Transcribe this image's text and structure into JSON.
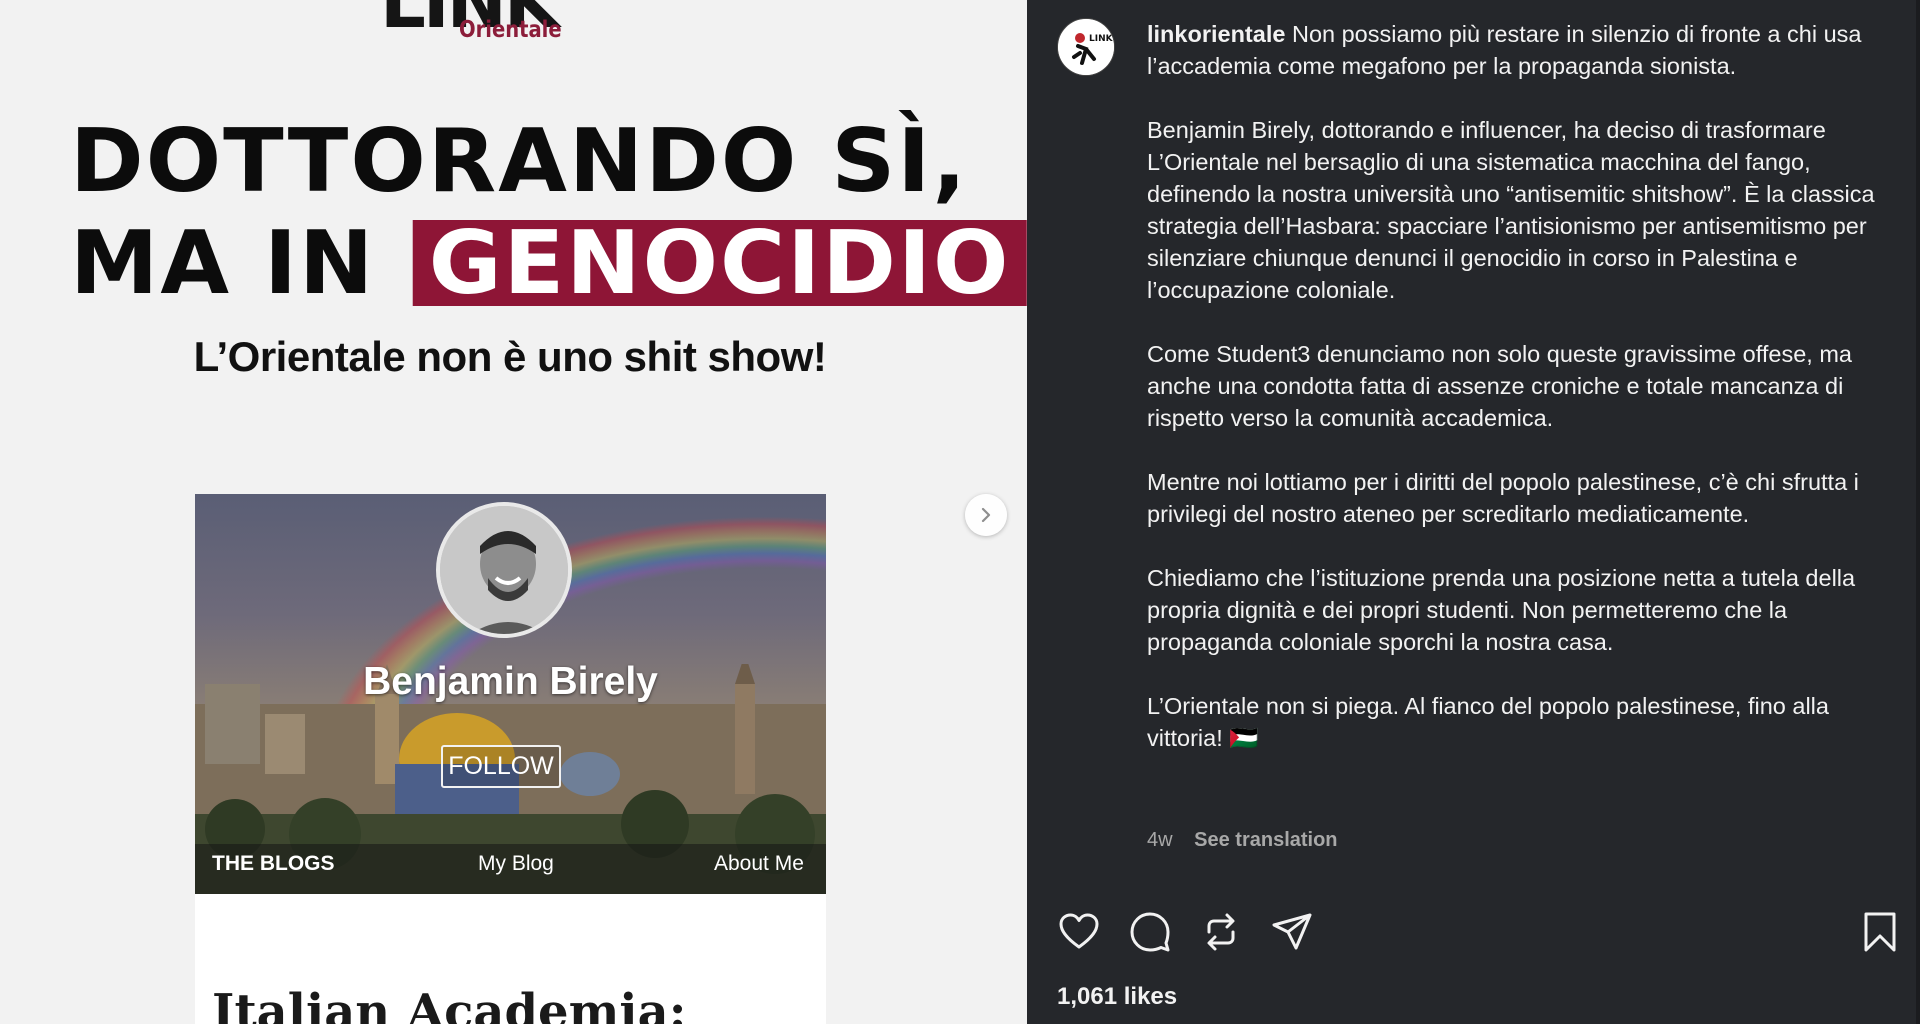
{
  "post_image": {
    "logo_word": "LINK",
    "logo_sub": "Orientale",
    "headline_line1": "DOTTORANDO SÌ,",
    "headline_line2_prefix": "MA IN",
    "headline_highlight": "GENOCIDIO",
    "subheadline": "L’Orientale non è uno shit show!",
    "blog": {
      "author_name": "Benjamin Birely",
      "follow_label": "FOLLOW",
      "nav": [
        "THE BLOGS",
        "My Blog",
        "About Me"
      ],
      "article_title": "Italian Academia:"
    }
  },
  "post": {
    "username": "linkorientale",
    "caption_first": "Non possiamo più restare in silenzio di fronte a chi usa l’accademia come megafono per la propaganda sionista.",
    "caption_paragraphs": [
      "Benjamin Birely, dottorando e influencer, ha deciso di trasformare L’Orientale nel bersaglio di una sistematica macchina del fango, definendo la nostra università uno “antisemitic shitshow”. È la classica strategia dell’Hasbara: spacciare l’antisionismo per antisemitismo per silenziare chiunque denunci il genocidio in corso in Palestina e l’occupazione coloniale.",
      "Come Student3 denunciamo non solo queste gravissime offese, ma anche una condotta fatta di assenze croniche e totale mancanza di rispetto verso la comunità accademica.",
      "Mentre noi lottiamo per i diritti del popolo palestinese, c’è chi sfrutta i privilegi del nostro ateneo per screditarlo mediaticamente.",
      "Chiediamo che l’istituzione prenda una posizione netta a tutela della propria dignità e dei propri studenti. Non permetteremo che la propaganda coloniale sporchi la nostra casa.",
      "L’Orientale non si piega. Al fianco del popolo palestinese, fino alla vittoria! 🇵🇸"
    ],
    "time_ago": "4w",
    "see_translation": "See translation",
    "likes": "1,061 likes"
  },
  "icons": {
    "like": "heart-icon",
    "comment": "comment-icon",
    "repost": "repost-icon",
    "share": "share-icon",
    "save": "bookmark-icon",
    "next": "chevron-right-icon"
  },
  "colors": {
    "brand_maroon": "#8e1536",
    "panel_bg": "#25272b"
  }
}
